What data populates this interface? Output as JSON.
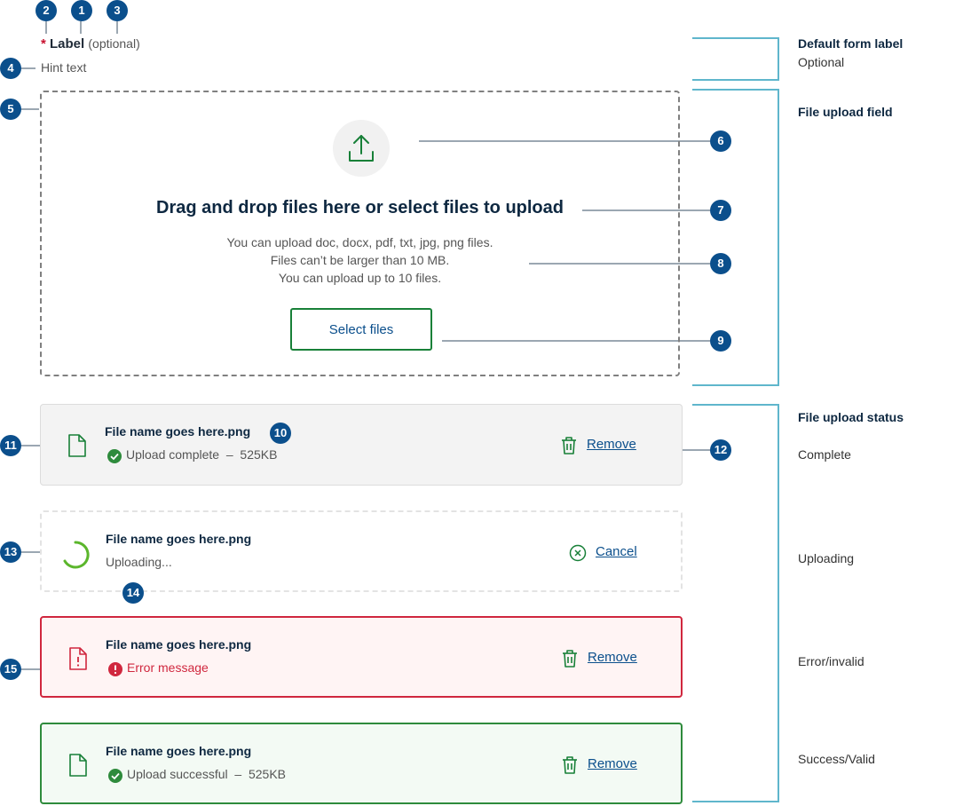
{
  "markers": [
    "1",
    "2",
    "3",
    "4",
    "5",
    "6",
    "7",
    "8",
    "9",
    "10",
    "11",
    "12",
    "13",
    "14",
    "15"
  ],
  "label": {
    "required_mark": "*",
    "text": "Label",
    "optional": "(optional)"
  },
  "hint": "Hint text",
  "dropzone": {
    "title": "Drag and drop files here or select files to upload",
    "desc_lines": [
      "You can upload doc, docx, pdf, txt, jpg, png files.",
      "Files can’t be larger than 10 MB.",
      "You can upload up to 10 files."
    ],
    "button": "Select files"
  },
  "files": {
    "complete": {
      "name": "File name goes here.png",
      "status": "Upload complete  –  525KB",
      "action": "Remove"
    },
    "uploading": {
      "name": "File name goes here.png",
      "status": "Uploading...",
      "action": "Cancel"
    },
    "error": {
      "name": "File name goes here.png",
      "status": "Error message",
      "action": "Remove"
    },
    "success": {
      "name": "File name goes here.png",
      "status": "Upload successful  –  525KB",
      "action": "Remove"
    }
  },
  "sidebar": {
    "form_label_title": "Default form label",
    "form_label_text": "Optional",
    "upload_field_title": "File upload field",
    "status_title": "File upload status",
    "states": [
      "Complete",
      "Uploading",
      "Error/invalid",
      "Success/Valid"
    ]
  },
  "colors": {
    "marker": "#0b4f8c",
    "bracket": "#5fb6cc",
    "primary_green": "#188038",
    "error": "#d0273e",
    "success": "#2e8b3c",
    "link": "#0b4f8c"
  },
  "icons": [
    "upload-icon",
    "file-icon",
    "check-circle-icon",
    "spinner-icon",
    "cancel-circle-icon",
    "trash-icon",
    "file-error-icon",
    "error-circle-icon"
  ]
}
